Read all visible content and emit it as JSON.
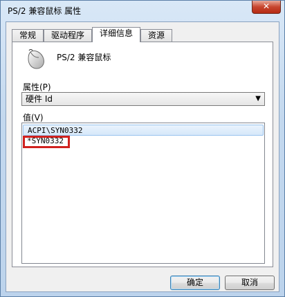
{
  "window": {
    "title": "PS/2 兼容鼠标 属性",
    "close_label": "✕"
  },
  "tabs": [
    {
      "label": "常规"
    },
    {
      "label": "驱动程序"
    },
    {
      "label": "详细信息",
      "active": true
    },
    {
      "label": "资源"
    }
  ],
  "device": {
    "name": "PS/2 兼容鼠标",
    "icon": "mouse-icon"
  },
  "property": {
    "label": "属性(P)",
    "selected": "硬件 Id"
  },
  "values": {
    "label": "值(V)",
    "items": [
      "ACPI\\SYN0332",
      "*SYN0332"
    ]
  },
  "buttons": {
    "ok": "确定",
    "cancel": "取消"
  }
}
